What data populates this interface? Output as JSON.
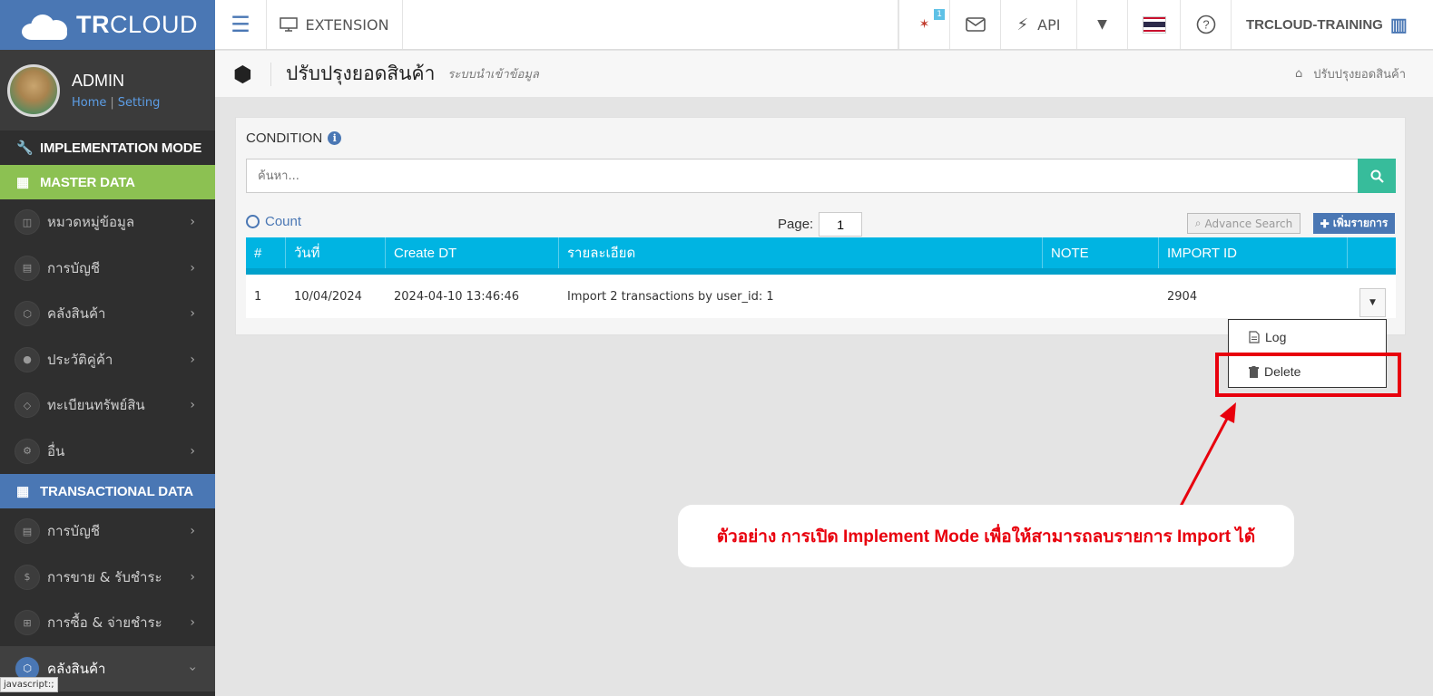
{
  "brand": {
    "name_bold": "TR",
    "name_thin": "CLOUD"
  },
  "profile": {
    "name": "ADMIN",
    "home_link": "Home",
    "link_sep": "|",
    "setting_link": "Setting"
  },
  "sidebar": {
    "implementation_mode": "IMPLEMENTATION MODE",
    "master_data": "MASTER DATA",
    "master_items": [
      {
        "label": "หมวดหมู่ข้อมูล",
        "icon": "book-icon"
      },
      {
        "label": "การบัญชี",
        "icon": "ledger-icon"
      },
      {
        "label": "คลังสินค้า",
        "icon": "cubes-icon"
      },
      {
        "label": "ประวัติคู่ค้า",
        "icon": "user-icon"
      },
      {
        "label": "ทะเบียนทรัพย์สิน",
        "icon": "diamond-icon"
      },
      {
        "label": "อื่น",
        "icon": "gear-icon"
      }
    ],
    "transactional_data": "TRANSACTIONAL DATA",
    "trans_items": [
      {
        "label": "การบัญชี",
        "icon": "ledger-icon"
      },
      {
        "label": "การขาย & รับชำระ",
        "icon": "dollar-icon"
      },
      {
        "label": "การซื้อ & จ่ายชำระ",
        "icon": "cart-icon"
      },
      {
        "label": "คลังสินค้า",
        "icon": "cubes-icon"
      }
    ],
    "status_tip": "javascript:;"
  },
  "topnav": {
    "extension_label": "EXTENSION",
    "news_badge": "1",
    "api_label": "API",
    "user_label": "TRCLOUD-TRAINING"
  },
  "page": {
    "title": "ปรับปรุงยอดสินค้า",
    "subtitle": "ระบบนำเข้าข้อมูล",
    "breadcrumb": "ปรับปรุงยอดสินค้า"
  },
  "filter": {
    "condition_label": "CONDITION",
    "search_placeholder": "ค้นหา...",
    "count_label": "Count",
    "page_label": "Page:",
    "page_value": "1",
    "advance_search": "Advance Search",
    "add_button": "เพิ่มรายการ"
  },
  "table": {
    "columns": [
      "#",
      "วันที่",
      "Create DT",
      "รายละเอียด",
      "NOTE",
      "IMPORT ID",
      ""
    ],
    "rows": [
      [
        "1",
        "10/04/2024",
        "2024-04-10 13:46:46",
        "Import 2 transactions by user_id: 1",
        "",
        "2904",
        ""
      ]
    ]
  },
  "dropdown": {
    "log": "Log",
    "delete": "Delete"
  },
  "annotation": {
    "callout": "ตัวอย่าง การเปิด Implement Mode เพื่อให้สามารถลบรายการ Import ได้"
  },
  "colors": {
    "accent": "#4a77b4",
    "master": "#8cc152",
    "table_header": "#00b4e2",
    "search_btn": "#37bc9b",
    "highlight": "#e8000d"
  }
}
